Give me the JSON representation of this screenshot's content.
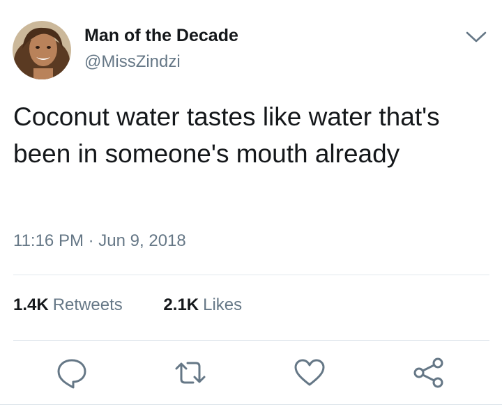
{
  "tweet": {
    "display_name": "Man of the Decade",
    "handle": "@MissZindzi",
    "text": "Coconut water tastes like water that's been in someone's mouth already",
    "time": "11:16 PM",
    "separator": "·",
    "date": "Jun 9, 2018"
  },
  "stats": {
    "retweets_count": "1.4K",
    "retweets_label": "Retweets",
    "likes_count": "2.1K",
    "likes_label": "Likes"
  },
  "icons": {
    "menu": "chevron-down-icon",
    "reply": "reply-icon",
    "retweet": "retweet-icon",
    "like": "heart-icon",
    "share": "share-icon"
  },
  "colors": {
    "text_primary": "#14171a",
    "text_secondary": "#657786",
    "icon": "#657786",
    "divider": "#e1e8ed"
  }
}
